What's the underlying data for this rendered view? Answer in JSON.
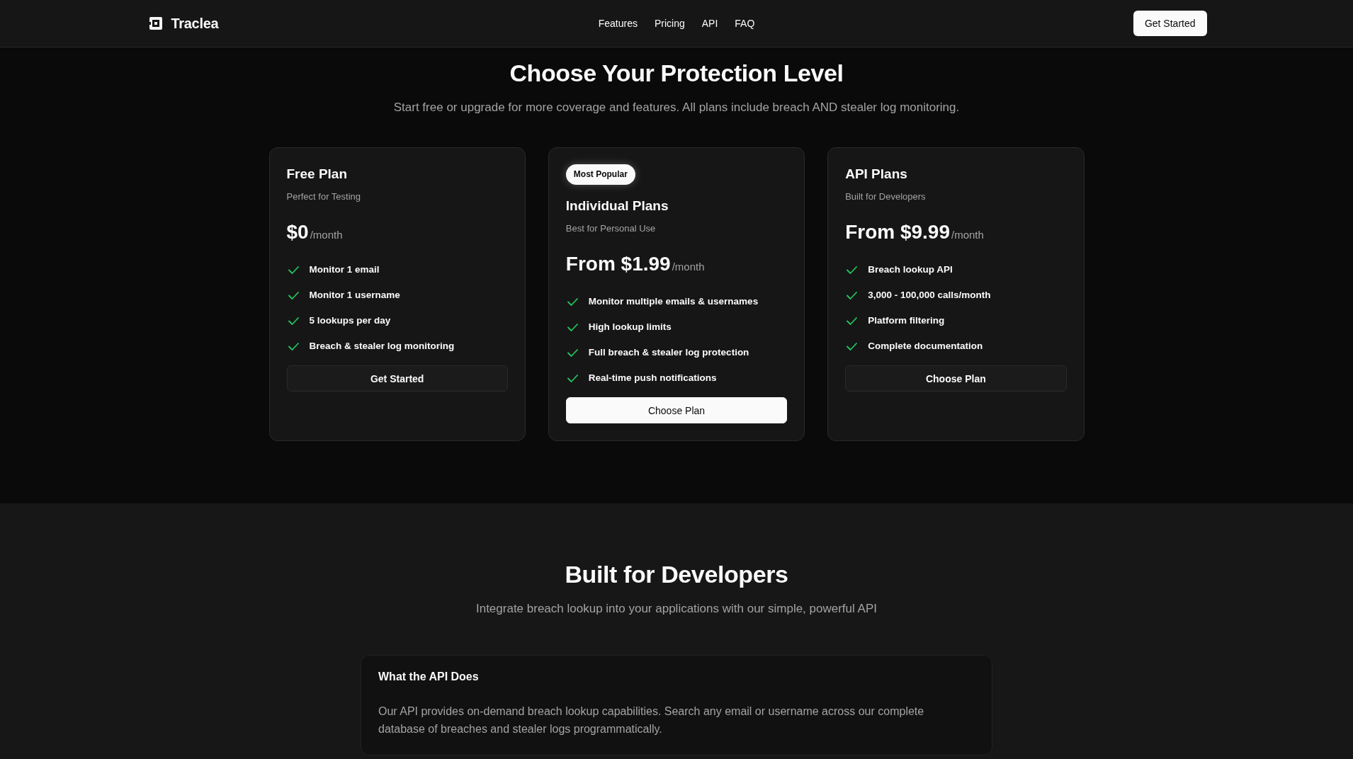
{
  "header": {
    "brand": "Traclea",
    "nav": [
      "Features",
      "Pricing",
      "API",
      "FAQ"
    ],
    "cta": "Get Started"
  },
  "pricing": {
    "title": "Choose Your Protection Level",
    "subtitle": "Start free or upgrade for more coverage and features. All plans include breach AND stealer log monitoring.",
    "plans": [
      {
        "name": "Free Plan",
        "tagline": "Perfect for Testing",
        "price": "$0",
        "period": "/month",
        "features": [
          "Monitor 1 email",
          "Monitor 1 username",
          "5 lookups per day",
          "Breach & stealer log monitoring"
        ],
        "button": "Get Started",
        "featured": false
      },
      {
        "badge": "Most Popular",
        "name": "Individual Plans",
        "tagline": "Best for Personal Use",
        "price": "From $1.99",
        "period": "/month",
        "features": [
          "Monitor multiple emails & usernames",
          "High lookup limits",
          "Full breach & stealer log protection",
          "Real-time push notifications"
        ],
        "button": "Choose Plan",
        "featured": true
      },
      {
        "name": "API Plans",
        "tagline": "Built for Developers",
        "price": "From $9.99",
        "period": "/month",
        "features": [
          "Breach lookup API",
          "3,000 - 100,000 calls/month",
          "Platform filtering",
          "Complete documentation"
        ],
        "button": "Choose Plan",
        "featured": false
      }
    ]
  },
  "developers": {
    "title": "Built for Developers",
    "subtitle": "Integrate breach lookup into your applications with our simple, powerful API",
    "card": {
      "heading": "What the API Does",
      "body": "Our API provides on-demand breach lookup capabilities. Search any email or username across our complete database of breaches and stealer logs programmatically."
    }
  }
}
